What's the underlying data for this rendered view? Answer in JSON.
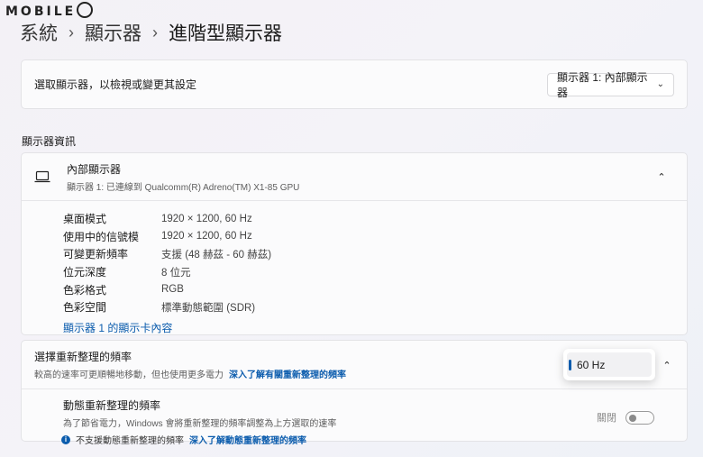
{
  "watermark": "MOBILE",
  "breadcrumb": {
    "items": [
      "系統",
      "顯示器",
      "進階型顯示器"
    ]
  },
  "select_display": {
    "label": "選取顯示器，以檢視或變更其設定",
    "dropdown_value": "顯示器 1: 內部顯示器"
  },
  "section_title": "顯示器資訊",
  "display_info": {
    "title": "內部顯示器",
    "subtitle": "顯示器 1: 已連線到 Qualcomm(R) Adreno(TM) X1-85 GPU",
    "props": [
      {
        "key": "桌面模式",
        "value": "1920 × 1200, 60 Hz"
      },
      {
        "key": "使用中的信號模",
        "value": "1920 × 1200, 60 Hz"
      },
      {
        "key": "可變更新頻率",
        "value": "支援 (48 赫茲 - 60 赫茲)"
      },
      {
        "key": "位元深度",
        "value": "8 位元"
      },
      {
        "key": "色彩格式",
        "value": "RGB"
      },
      {
        "key": "色彩空間",
        "value": "標準動態範圍 (SDR)"
      }
    ],
    "adapter_link": "顯示器 1 的顯示卡內容"
  },
  "refresh_rate": {
    "title": "選擇重新整理的頻率",
    "desc": "較高的速率可更順暢地移動，但也使用更多電力",
    "link": "深入了解有關重新整理的頻率",
    "selected": "60 Hz"
  },
  "dynamic_refresh": {
    "title": "動態重新整理的頻率",
    "desc": "為了節省電力，Windows 會將重新整理的頻率調整為上方選取的速率",
    "note": "不支援動態重新整理的頻率",
    "note_link": "深入了解動態重新整理的頻率",
    "toggle_label": "關閉",
    "toggle_on": false
  },
  "colors": {
    "accent": "#0b5cad",
    "card_bg": "#fbfbfc"
  }
}
